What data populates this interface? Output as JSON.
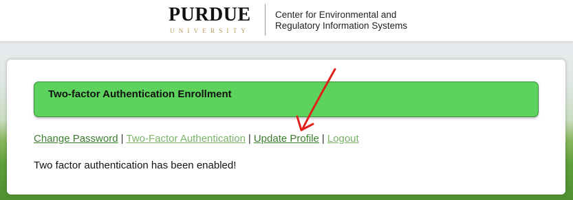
{
  "header": {
    "logo_wordmark": "PURDUE",
    "logo_sub": "UNIVERSITY",
    "center_line1": "Center for Environmental and",
    "center_line2": "Regulatory Information Systems"
  },
  "panel": {
    "title": "Two-factor Authentication Enrollment",
    "nav": [
      {
        "label": "Change Password"
      },
      {
        "label": "Two-Factor Authentication"
      },
      {
        "label": "Update Profile"
      },
      {
        "label": "Logout"
      }
    ],
    "separator": "|",
    "message": "Two factor authentication has been enabled!"
  },
  "colors": {
    "enroll_box": "#5dd35d",
    "link": "#3a7d2c",
    "current_link": "#78b368",
    "annotation_arrow": "#e0201b",
    "purdue_gold": "#b39a55"
  },
  "icons": {
    "annotation": "red-arrow-icon"
  }
}
